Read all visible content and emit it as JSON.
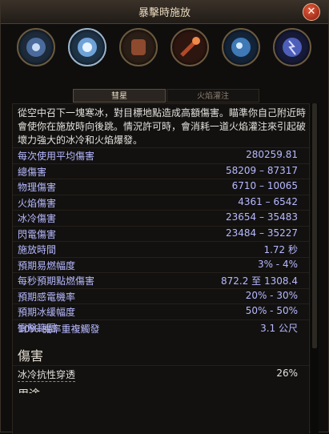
{
  "window": {
    "title": "暴擊時施放",
    "close_icon": "close-icon"
  },
  "skills": [
    {
      "name": "ice-nova-icon",
      "color": "#4b6b9c"
    },
    {
      "name": "meteor-ice-icon",
      "color": "#6fa3d8"
    },
    {
      "name": "chest-armor-icon",
      "color": "#8d4a2e"
    },
    {
      "name": "fire-wand-icon",
      "color": "#b04a2a"
    },
    {
      "name": "frost-orb-icon",
      "color": "#3f79b6"
    },
    {
      "name": "lightning-orb-icon",
      "color": "#4d5fb8"
    }
  ],
  "tabs": [
    {
      "label": "彗星"
    },
    {
      "label": "火焰灌注"
    }
  ],
  "description": "從空中召下一塊寒冰，對目標地點造成高額傷害。瞄準你自己附近時會使你在施放時向後跳。情況許可時，會消耗一道火焰灌注來引起破壞力強大的冰冷和火焰爆發。",
  "stats": [
    {
      "label": "每次使用平均傷害",
      "value": "280259.81"
    },
    {
      "label": "總傷害",
      "value": "58209 – 87317"
    },
    {
      "label": "物理傷害",
      "value": "6710 – 10065"
    },
    {
      "label": "火焰傷害",
      "value": "4361 – 6542"
    },
    {
      "label": "冰冷傷害",
      "value": "23654 – 35483"
    },
    {
      "label": "閃電傷害",
      "value": "23484 – 35227"
    },
    {
      "label": "施放時間",
      "value": "1.72 秒"
    },
    {
      "label": "預期易燃幅度",
      "value": "3% - 4%"
    },
    {
      "label": "每秒預期點燃傷害",
      "value": "872.2 至 1308.4"
    },
    {
      "label": "預期感電機率",
      "value": "20% - 30%"
    },
    {
      "label": "預期冰緩幅度",
      "value": "50% - 50%"
    },
    {
      "label": "衝擊範圍",
      "value": "3.1 公尺"
    }
  ],
  "proc_text": "10% 機率重複觸發",
  "section_title": "傷害",
  "damage_rows": [
    {
      "label": "冰冷抗性穿透",
      "value": "26%"
    }
  ],
  "next_section_partial": "用途"
}
